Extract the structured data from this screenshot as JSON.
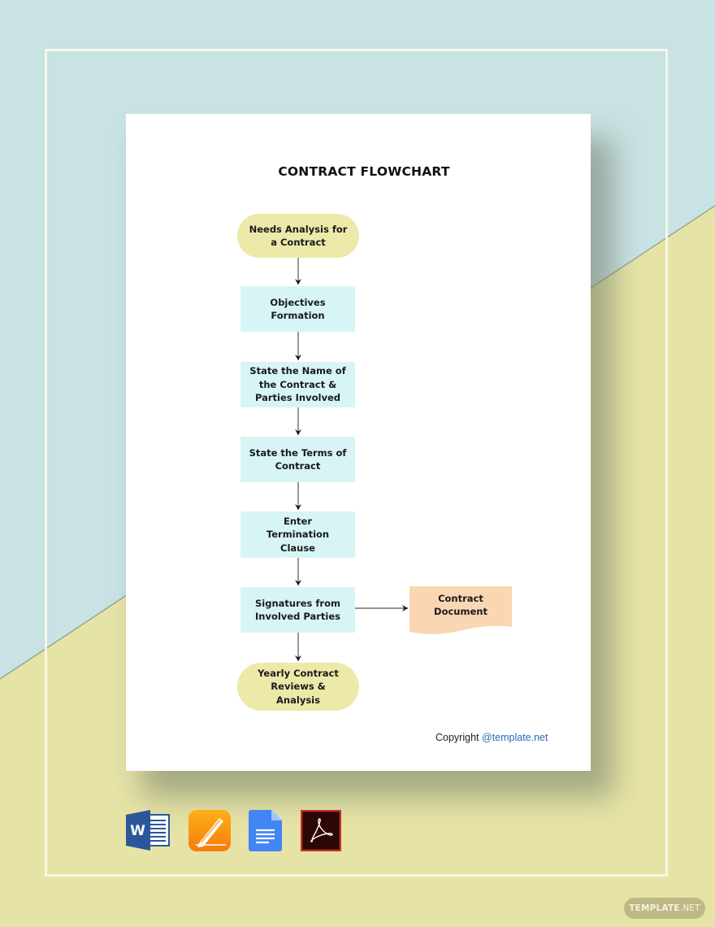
{
  "document": {
    "title": "CONTRACT FLOWCHART",
    "copyright_label": "Copyright",
    "copyright_link": "@template.net"
  },
  "flowchart": {
    "nodes": [
      {
        "id": "n1",
        "type": "terminator",
        "label": "Needs Analysis for a Contract",
        "lines": [
          "Needs Analysis for",
          "a Contract"
        ]
      },
      {
        "id": "n2",
        "type": "process",
        "label": "Objectives Formation",
        "lines": [
          "Objectives",
          "Formation"
        ]
      },
      {
        "id": "n3",
        "type": "process",
        "label": "State the Name of the Contract & Parties Involved",
        "lines": [
          "State the Name of",
          "the Contract &",
          "Parties Involved"
        ]
      },
      {
        "id": "n4",
        "type": "process",
        "label": "State the Terms of Contract",
        "lines": [
          "State the Terms of",
          "Contract"
        ]
      },
      {
        "id": "n5",
        "type": "process",
        "label": "Enter Termination Clause",
        "lines": [
          "Enter Termination",
          "Clause"
        ]
      },
      {
        "id": "n6",
        "type": "process",
        "label": "Signatures from Involved Parties",
        "lines": [
          "Signatures from",
          "Involved Parties"
        ]
      },
      {
        "id": "n7",
        "type": "document",
        "label": "Contract Document",
        "lines": [
          "Contract",
          "Document"
        ]
      },
      {
        "id": "n8",
        "type": "terminator",
        "label": "Yearly Contract Reviews & Analysis",
        "lines": [
          "Yearly Contract",
          "Reviews &",
          "Analysis"
        ]
      }
    ],
    "edges": [
      {
        "from": "n1",
        "to": "n2"
      },
      {
        "from": "n2",
        "to": "n3"
      },
      {
        "from": "n3",
        "to": "n4"
      },
      {
        "from": "n4",
        "to": "n5"
      },
      {
        "from": "n5",
        "to": "n6"
      },
      {
        "from": "n6",
        "to": "n7"
      },
      {
        "from": "n6",
        "to": "n8"
      }
    ]
  },
  "colors": {
    "terminator": "#ece9a9",
    "process": "#d8f5f6",
    "document": "#fbd6b2",
    "background_top": "#c9e2e3",
    "background_bottom": "#e6e3a6",
    "link": "#2a6ab5"
  },
  "format_icons": [
    {
      "name": "word-icon",
      "label": "Microsoft Word"
    },
    {
      "name": "pages-icon",
      "label": "Apple Pages"
    },
    {
      "name": "google-docs-icon",
      "label": "Google Docs"
    },
    {
      "name": "acrobat-pdf-icon",
      "label": "Adobe Acrobat PDF"
    }
  ],
  "watermark": {
    "bold": "TEMPLATE",
    "light": ".NET"
  }
}
